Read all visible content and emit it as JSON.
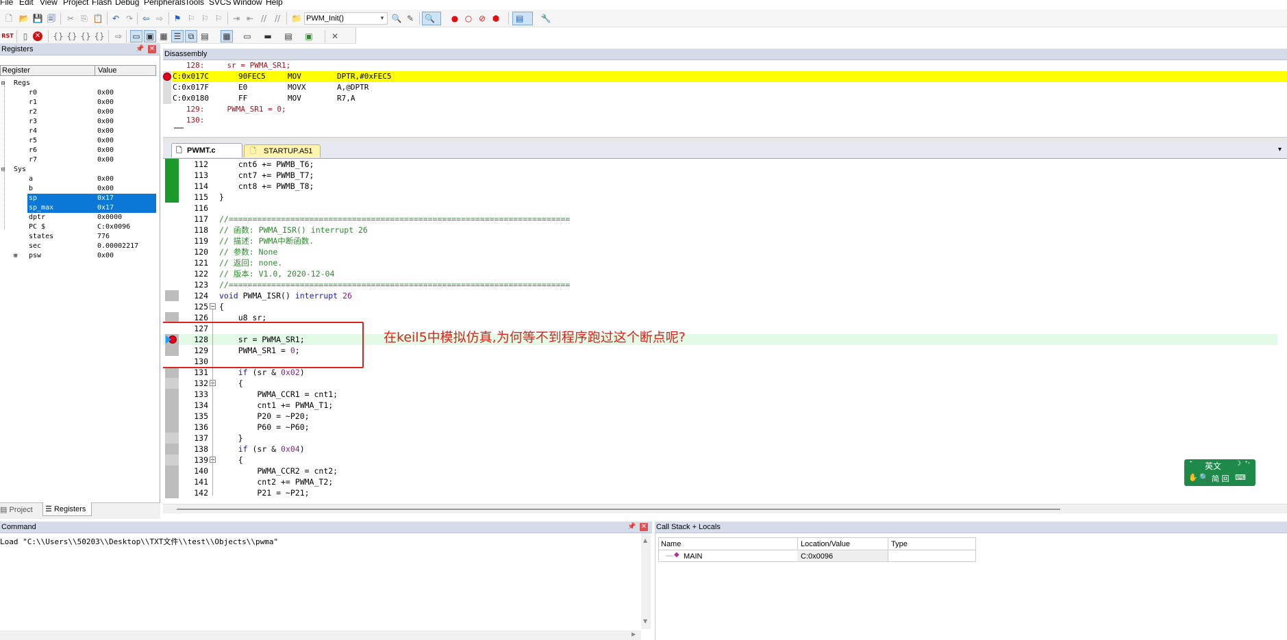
{
  "menu": [
    "File",
    "Edit",
    "View",
    "Project",
    "Flash",
    "Debug",
    "Peripherals",
    "Tools",
    "SVCS",
    "Window",
    "Help"
  ],
  "toolbar": {
    "target_combo": "PWM_Init()"
  },
  "registers": {
    "title": "Registers",
    "col_register": "Register",
    "col_value": "Value",
    "groups": [
      {
        "name": "Regs",
        "items": [
          {
            "name": "r0",
            "value": "0x00"
          },
          {
            "name": "r1",
            "value": "0x00"
          },
          {
            "name": "r2",
            "value": "0x00"
          },
          {
            "name": "r3",
            "value": "0x00"
          },
          {
            "name": "r4",
            "value": "0x00"
          },
          {
            "name": "r5",
            "value": "0x00"
          },
          {
            "name": "r6",
            "value": "0x00"
          },
          {
            "name": "r7",
            "value": "0x00"
          }
        ]
      },
      {
        "name": "Sys",
        "items": [
          {
            "name": "a",
            "value": "0x00"
          },
          {
            "name": "b",
            "value": "0x00"
          },
          {
            "name": "sp",
            "value": "0x17"
          },
          {
            "name": "sp_max",
            "value": "0x17"
          },
          {
            "name": "dptr",
            "value": "0x0000"
          },
          {
            "name": "PC  $",
            "value": "C:0x0096"
          },
          {
            "name": "states",
            "value": "776"
          },
          {
            "name": "sec",
            "value": "0.00002217"
          },
          {
            "name": "psw",
            "value": "0x00"
          }
        ]
      }
    ],
    "tabs": [
      "Project",
      "Registers"
    ]
  },
  "disassembly": {
    "title": "Disassembly",
    "lines": [
      {
        "addr": "",
        "code": "",
        "mn": "",
        "op": "",
        "src": "   128:     sr = PWMA_SR1;"
      },
      {
        "addr": "C:0x017C",
        "code": "90FEC5",
        "mn": "MOV",
        "op": "DPTR,#0xFEC5",
        "src": ""
      },
      {
        "addr": "C:0x017F",
        "code": "E0",
        "mn": "MOVX",
        "op": "A,@DPTR",
        "src": ""
      },
      {
        "addr": "C:0x0180",
        "code": "FF",
        "mn": "MOV",
        "op": "R7,A",
        "src": ""
      },
      {
        "addr": "",
        "code": "",
        "mn": "",
        "op": "",
        "src": "   129:     PWMA_SR1 = 0;"
      },
      {
        "addr": "",
        "code": "",
        "mn": "",
        "op": "",
        "src": "   130:"
      }
    ]
  },
  "editor": {
    "tabs": [
      "PWMT.c",
      "STARTUP.A51"
    ],
    "lines": [
      {
        "n": "112",
        "t": "    cnt6 += PWMB_T6;"
      },
      {
        "n": "113",
        "t": "    cnt7 += PWMB_T7;"
      },
      {
        "n": "114",
        "t": "    cnt8 += PWMB_T8;"
      },
      {
        "n": "115",
        "t": "}"
      },
      {
        "n": "116",
        "t": ""
      },
      {
        "n": "117",
        "t": "//========================================================================"
      },
      {
        "n": "118",
        "t": "// 函数: PWMA_ISR() interrupt 26"
      },
      {
        "n": "119",
        "t": "// 描述: PWMA中断函数."
      },
      {
        "n": "120",
        "t": "// 参数: None"
      },
      {
        "n": "121",
        "t": "// 返回: none."
      },
      {
        "n": "122",
        "t": "// 版本: V1.0, 2020-12-04"
      },
      {
        "n": "123",
        "t": "//========================================================================"
      },
      {
        "n": "124",
        "t": "void PWMA_ISR() interrupt 26"
      },
      {
        "n": "125",
        "t": "{"
      },
      {
        "n": "126",
        "t": "    u8 sr;"
      },
      {
        "n": "127",
        "t": ""
      },
      {
        "n": "128",
        "t": "    sr = PWMA_SR1;"
      },
      {
        "n": "129",
        "t": "    PWMA_SR1 = 0;"
      },
      {
        "n": "130",
        "t": ""
      },
      {
        "n": "131",
        "t": "    if (sr & 0x02)"
      },
      {
        "n": "132",
        "t": "    {"
      },
      {
        "n": "133",
        "t": "        PWMA_CCR1 = cnt1;"
      },
      {
        "n": "134",
        "t": "        cnt1 += PWMA_T1;"
      },
      {
        "n": "135",
        "t": "        P20 = ~P20;"
      },
      {
        "n": "136",
        "t": "        P60 = ~P60;"
      },
      {
        "n": "137",
        "t": "    }"
      },
      {
        "n": "138",
        "t": "    if (sr & 0x04)"
      },
      {
        "n": "139",
        "t": "    {"
      },
      {
        "n": "140",
        "t": "        PWMA_CCR2 = cnt2;"
      },
      {
        "n": "141",
        "t": "        cnt2 += PWMA_T2;"
      },
      {
        "n": "142",
        "t": "        P21 = ~P21;"
      }
    ],
    "annotation": "在keil5中模拟仿真,为何等不到程序跑过这个断点呢?"
  },
  "ime": {
    "lang": "英文",
    "moon": "☽",
    "arrows": "⁺˒",
    "line2": "简 回"
  },
  "command": {
    "title": "Command",
    "text": "Load \"C:\\\\Users\\\\50203\\\\Desktop\\\\TXT文件\\\\test\\\\Objects\\\\pwma\""
  },
  "callstack": {
    "title": "Call Stack + Locals",
    "cols": [
      "Name",
      "Location/Value",
      "Type"
    ],
    "rows": [
      {
        "name": "MAIN",
        "loc": "C:0x0096",
        "type": ""
      }
    ]
  },
  "colors": {
    "breakpoint": "#e8001c",
    "exec_highlight": "#ffff00",
    "coverage": "#1a9a2a",
    "selection": "#0b77d6",
    "annotation": "#e0231a"
  }
}
